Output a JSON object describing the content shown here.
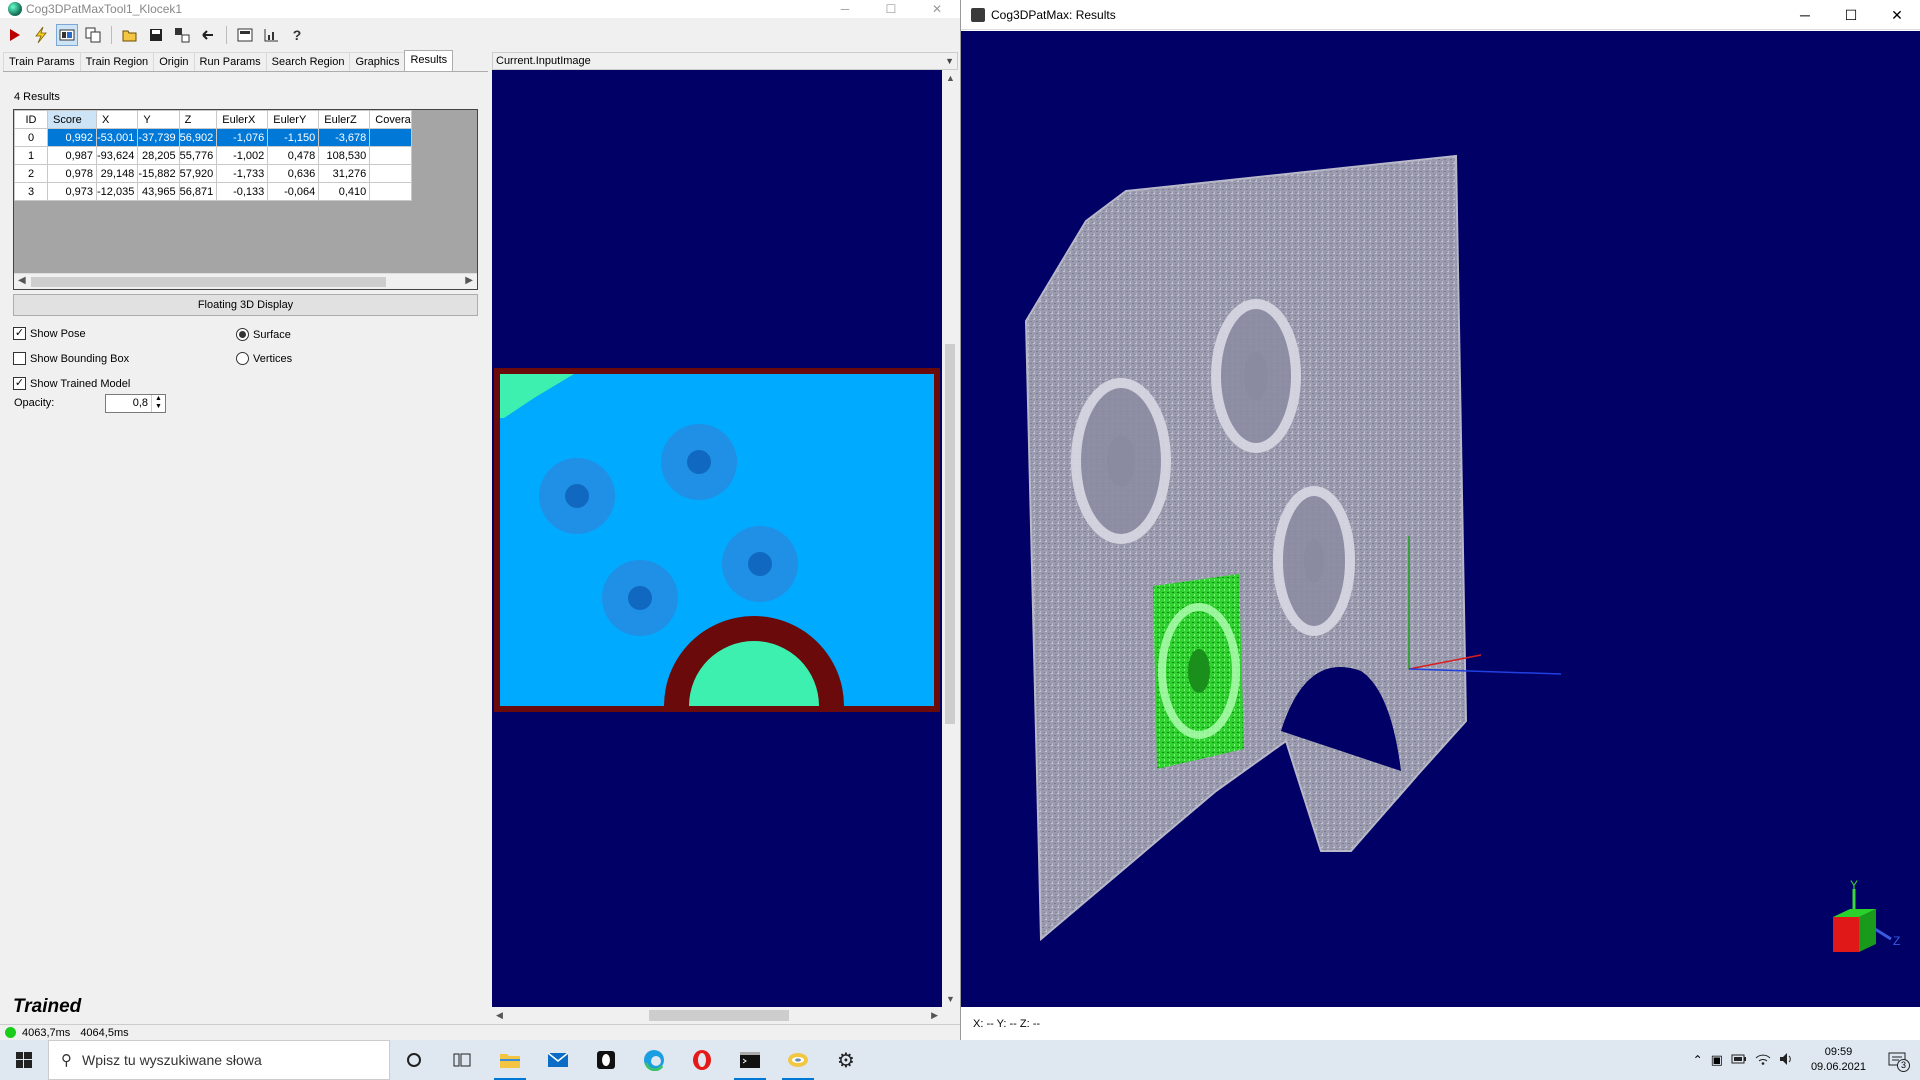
{
  "left_window": {
    "title": "Cog3DPatMaxTool1_Klocek1",
    "caption_buttons": [
      "─",
      "☐",
      "✕"
    ],
    "tabs": [
      "Train Params",
      "Train Region",
      "Origin",
      "Run Params",
      "Search Region",
      "Graphics",
      "Results"
    ],
    "active_tab": "Results",
    "results_count": "4 Results",
    "columns": [
      "ID",
      "Score",
      "X",
      "Y",
      "Z",
      "EulerX",
      "EulerY",
      "EulerZ",
      "Covera"
    ],
    "rows": [
      [
        "0",
        "0,992",
        "-53,001",
        "-37,739",
        "56,902",
        "-1,076",
        "-1,150",
        "-3,678",
        ""
      ],
      [
        "1",
        "0,987",
        "-93,624",
        "28,205",
        "55,776",
        "-1,002",
        "0,478",
        "108,530",
        ""
      ],
      [
        "2",
        "0,978",
        "29,148",
        "-15,882",
        "57,920",
        "-1,733",
        "0,636",
        "31,276",
        ""
      ],
      [
        "3",
        "0,973",
        "-12,035",
        "43,965",
        "56,871",
        "-0,133",
        "-0,064",
        "0,410",
        ""
      ]
    ],
    "floating_button": "Floating 3D Display",
    "show_pose": "Show Pose",
    "show_bounding_box": "Show Bounding Box",
    "show_trained_model": "Show Trained Model",
    "surface": "Surface",
    "vertices": "Vertices",
    "opacity_label": "Opacity:",
    "opacity_value": "0,8",
    "trained_status": "Trained",
    "status_time1": "4063,7ms",
    "status_time2": "4064,5ms",
    "image_selector": "Current.InputImage"
  },
  "right_window": {
    "title": "Cog3DPatMax: Results",
    "caption_buttons": [
      "─",
      "☐",
      "✕"
    ],
    "coords": "X: --  Y: --  Z: --",
    "axis_y": "Y",
    "axis_z": "Z"
  },
  "taskbar": {
    "search_placeholder": "Wpisz tu wyszukiwane słowa",
    "time": "09:59",
    "date": "09.06.2021",
    "notif_count": "3"
  },
  "colors": {
    "viewport_bg": "#000066",
    "selection": "#0078d7",
    "depth_cyan": "#00aaff",
    "depth_mint": "#3ef0b0",
    "depth_maroon": "#6a0a0a"
  }
}
